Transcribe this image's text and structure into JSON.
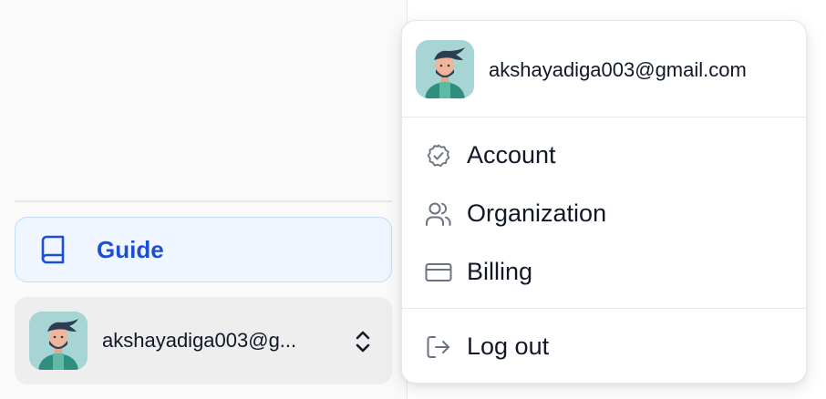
{
  "sidebar": {
    "guide_label": "Guide",
    "user_email_truncated": "akshayadiga003@g..."
  },
  "menu": {
    "user_email": "akshayadiga003@gmail.com",
    "items": [
      {
        "label": "Account",
        "icon": "badge-check-icon"
      },
      {
        "label": "Organization",
        "icon": "users-icon"
      },
      {
        "label": "Billing",
        "icon": "credit-card-icon"
      },
      {
        "label": "Log out",
        "icon": "log-out-icon"
      }
    ]
  },
  "colors": {
    "accent": "#1d4ed8",
    "guide_bg": "#eff6ff",
    "avatar_bg": "#a7d5d4"
  }
}
